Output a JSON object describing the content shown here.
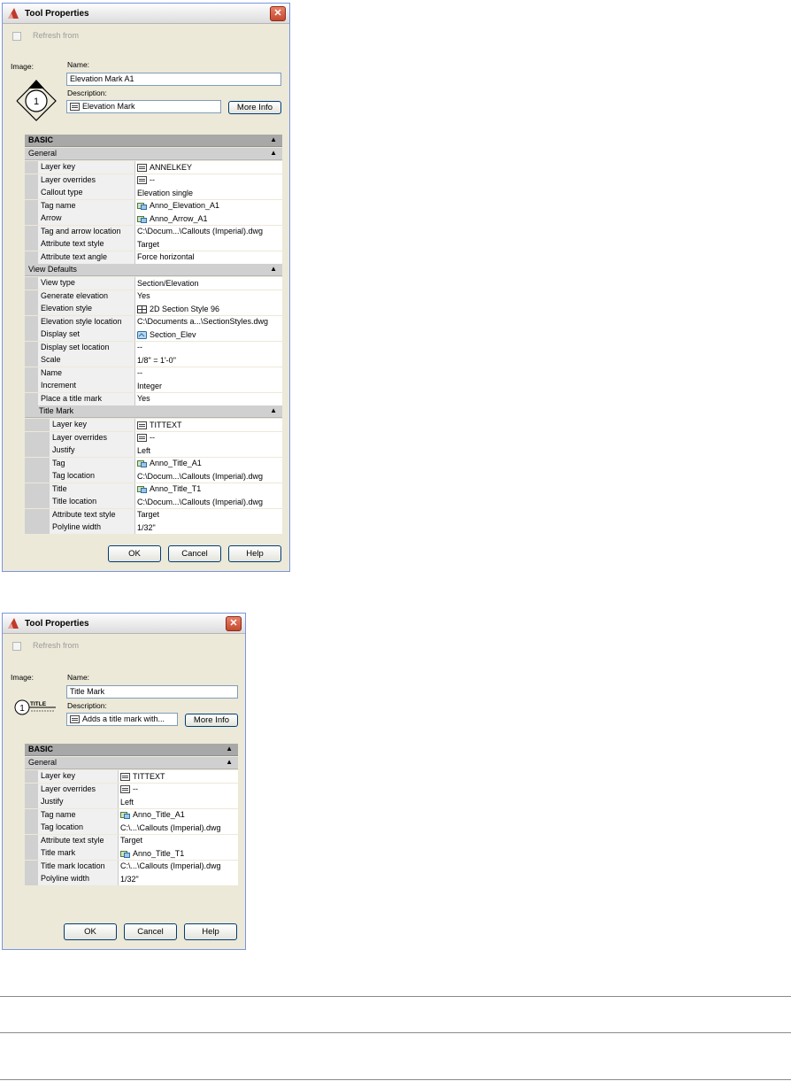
{
  "dialog1": {
    "title": "Tool Properties",
    "close_glyph": "✕",
    "refresh_label": "Refresh from",
    "image_label": "Image:",
    "name_label": "Name:",
    "name_value": "Elevation Mark A1",
    "description_label": "Description:",
    "description_value": "Elevation Mark",
    "more_info_label": "More Info",
    "preview_number": "1",
    "basic_label": "BASIC",
    "general_label": "General",
    "general_rows": [
      {
        "name": "Layer key",
        "value": "ANNELKEY",
        "icon": "list-icon"
      },
      {
        "name": "Layer overrides",
        "value": "--",
        "icon": "list-icon"
      },
      {
        "name": "Callout type",
        "value": "Elevation single",
        "icon": ""
      },
      {
        "name": "Tag name",
        "value": "Anno_Elevation_A1",
        "icon": "block-icon"
      },
      {
        "name": "Arrow",
        "value": "Anno_Arrow_A1",
        "icon": "block-icon"
      },
      {
        "name": "Tag and arrow location",
        "value": "C:\\Docum...\\Callouts (Imperial).dwg",
        "icon": ""
      },
      {
        "name": "Attribute text style",
        "value": "Target",
        "icon": ""
      },
      {
        "name": "Attribute text angle",
        "value": "Force horizontal",
        "icon": ""
      }
    ],
    "view_defaults_label": "View Defaults",
    "view_rows": [
      {
        "name": "View type",
        "value": "Section/Elevation",
        "icon": ""
      },
      {
        "name": "Generate elevation",
        "value": "Yes",
        "icon": ""
      },
      {
        "name": "Elevation style",
        "value": "2D Section Style 96",
        "icon": "section-style-icon"
      },
      {
        "name": "Elevation style location",
        "value": "C:\\Documents a...\\SectionStyles.dwg",
        "icon": ""
      },
      {
        "name": "Display set",
        "value": "Section_Elev",
        "icon": "display-set-icon"
      },
      {
        "name": "Display set location",
        "value": "--",
        "icon": ""
      },
      {
        "name": "Scale",
        "value": "1/8\" = 1'-0\"",
        "icon": ""
      },
      {
        "name": "Name",
        "value": "--",
        "icon": ""
      },
      {
        "name": "Increment",
        "value": "Integer",
        "icon": ""
      },
      {
        "name": "Place a title mark",
        "value": "Yes",
        "icon": ""
      }
    ],
    "title_mark_label": "Title Mark",
    "title_rows": [
      {
        "name": "Layer key",
        "value": "TITTEXT",
        "icon": "list-icon"
      },
      {
        "name": "Layer overrides",
        "value": "--",
        "icon": "list-icon"
      },
      {
        "name": "Justify",
        "value": "Left",
        "icon": ""
      },
      {
        "name": "Tag",
        "value": "Anno_Title_A1",
        "icon": "block-icon"
      },
      {
        "name": "Tag location",
        "value": "C:\\Docum...\\Callouts (Imperial).dwg",
        "icon": ""
      },
      {
        "name": "Title",
        "value": "Anno_Title_T1",
        "icon": "block-icon"
      },
      {
        "name": "Title location",
        "value": "C:\\Docum...\\Callouts (Imperial).dwg",
        "icon": ""
      },
      {
        "name": "Attribute text style",
        "value": "Target",
        "icon": ""
      },
      {
        "name": "Polyline width",
        "value": "1/32\"",
        "icon": ""
      }
    ],
    "ok_label": "OK",
    "cancel_label": "Cancel",
    "help_label": "Help"
  },
  "dialog2": {
    "title": "Tool Properties",
    "close_glyph": "✕",
    "refresh_label": "Refresh from",
    "image_label": "Image:",
    "name_label": "Name:",
    "name_value": "Title Mark",
    "description_label": "Description:",
    "description_value": "Adds a title mark with...",
    "more_info_label": "More Info",
    "preview_number": "1",
    "preview_title": "TITLE",
    "basic_label": "BASIC",
    "general_label": "General",
    "general_rows": [
      {
        "name": "Layer key",
        "value": "TITTEXT",
        "icon": "list-icon"
      },
      {
        "name": "Layer overrides",
        "value": "--",
        "icon": "list-icon"
      },
      {
        "name": "Justify",
        "value": "Left",
        "icon": ""
      },
      {
        "name": "Tag name",
        "value": "Anno_Title_A1",
        "icon": "block-icon"
      },
      {
        "name": "Tag location",
        "value": "C:\\...\\Callouts (Imperial).dwg",
        "icon": ""
      },
      {
        "name": "Attribute text style",
        "value": "Target",
        "icon": ""
      },
      {
        "name": "Title mark",
        "value": "Anno_Title_T1",
        "icon": "block-icon"
      },
      {
        "name": "Title mark location",
        "value": "C:\\...\\Callouts (Imperial).dwg",
        "icon": ""
      },
      {
        "name": "Polyline width",
        "value": "1/32\"",
        "icon": ""
      }
    ],
    "ok_label": "OK",
    "cancel_label": "Cancel",
    "help_label": "Help"
  },
  "colors": {
    "dialog_bg": "#ece9d8",
    "group_header": "#a8a8a8",
    "subgroup_header": "#d0d0d0",
    "close_button": "#c44a2e"
  }
}
